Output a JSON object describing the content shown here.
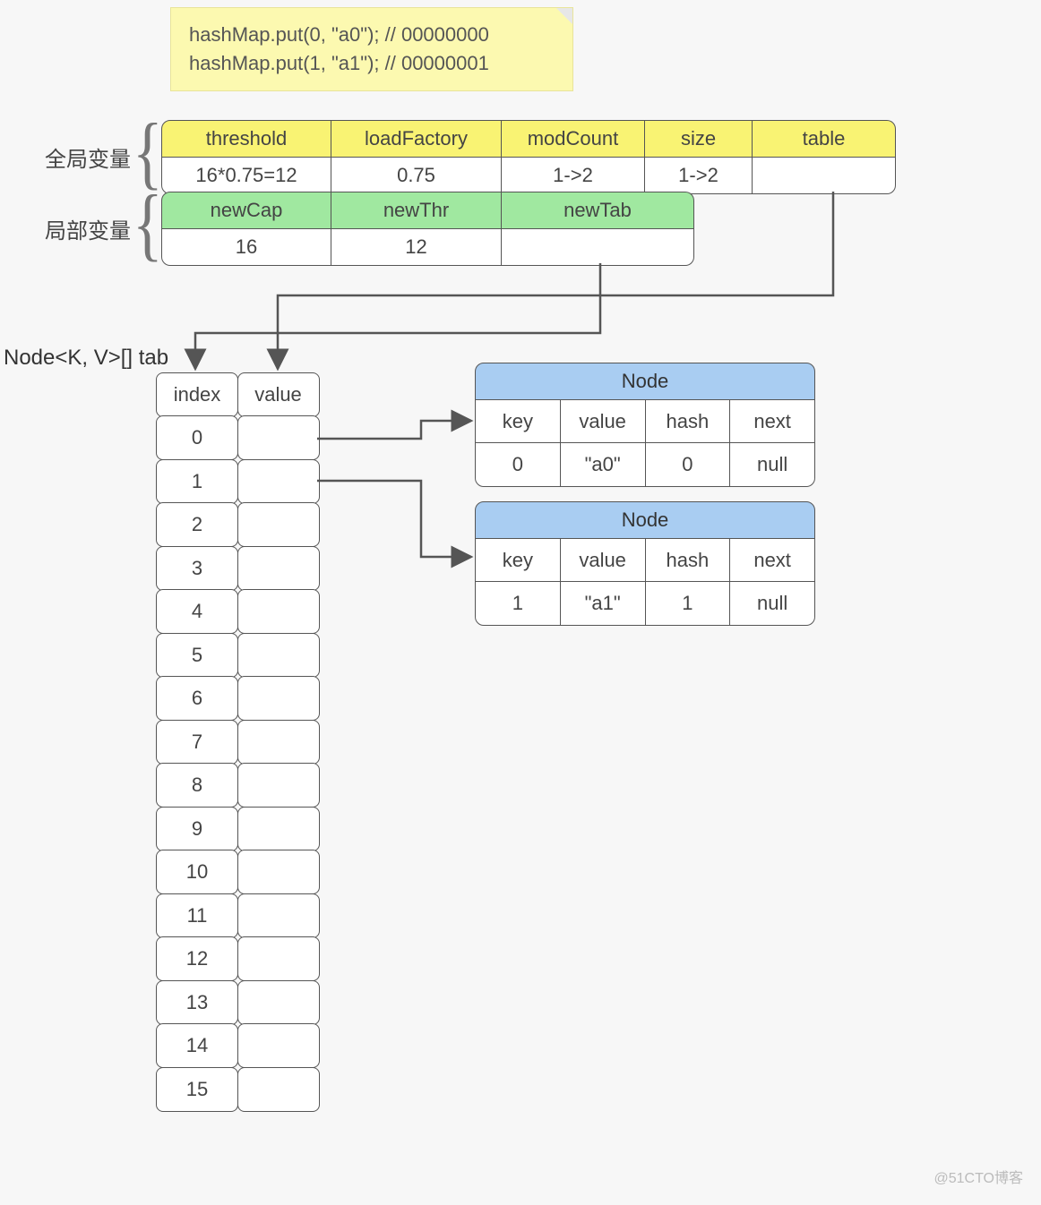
{
  "note": {
    "line1": "hashMap.put(0, \"a0\");    // 00000000",
    "line2": "hashMap.put(1, \"a1\");    // 00000001"
  },
  "labels": {
    "global": "全局变量",
    "local": "局部变量",
    "tab": "Node<K, V>[] tab"
  },
  "globalVars": {
    "headers": [
      "threshold",
      "loadFactory",
      "modCount",
      "size",
      "table"
    ],
    "values": [
      "16*0.75=12",
      "0.75",
      "1->2",
      "1->2",
      ""
    ]
  },
  "localVars": {
    "headers": [
      "newCap",
      "newThr",
      "newTab"
    ],
    "values": [
      "16",
      "12",
      ""
    ]
  },
  "tabArray": {
    "headers": [
      "index",
      "value"
    ],
    "indices": [
      "0",
      "1",
      "2",
      "3",
      "4",
      "5",
      "6",
      "7",
      "8",
      "9",
      "10",
      "11",
      "12",
      "13",
      "14",
      "15"
    ]
  },
  "nodeTitle": "Node",
  "nodeHeaders": [
    "key",
    "value",
    "hash",
    "next"
  ],
  "node0": [
    "0",
    "\"a0\"",
    "0",
    "null"
  ],
  "node1": [
    "1",
    "\"a1\"",
    "1",
    "null"
  ],
  "watermark": "@51CTO博客"
}
